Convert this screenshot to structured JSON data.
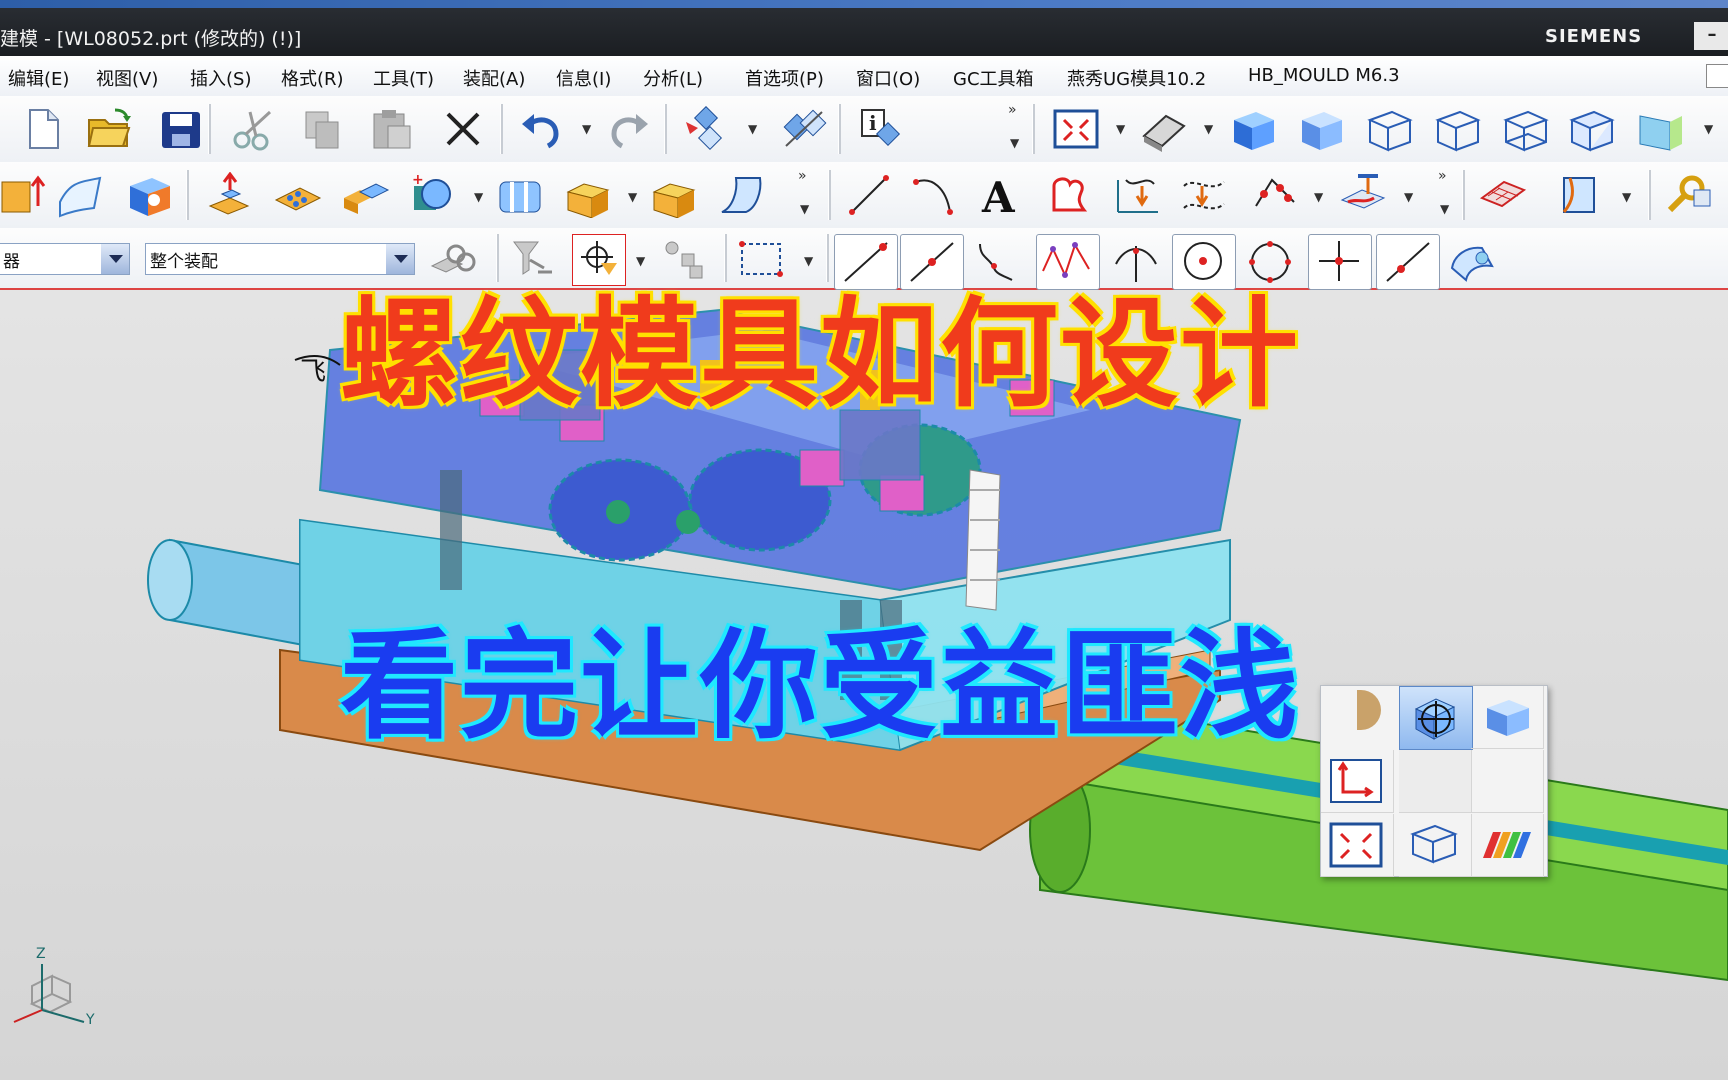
{
  "window": {
    "title": "建模 - [WL08052.prt  (修改的)     (!)]",
    "brand": "SIEMENS",
    "minimize": "–"
  },
  "menu": [
    "编辑(E)",
    "视图(V)",
    "插入(S)",
    "格式(R)",
    "工具(T)",
    "装配(A)",
    "信息(I)",
    "分析(L)",
    "首选项(P)",
    "窗口(O)",
    "GC工具箱",
    "燕秀UG模具10.2",
    "HB_MOULD M6.3"
  ],
  "selection_bar": {
    "filter_value": "器",
    "scope_value": "整个装配"
  },
  "viewport": {
    "sketch_text": "飞",
    "triad_axes": {
      "z": "Z",
      "y": "Y"
    }
  },
  "overlay": {
    "title": "螺纹模具如何设计",
    "subtitle": "看完让你受益匪浅"
  },
  "colors": {
    "title_red": "#f03b1c",
    "title_outline": "#ffe000",
    "subtitle_blue": "#1a3cf0",
    "subtitle_outline": "#20e8ff",
    "mold_blue": "#5b78e0",
    "mold_cyan": "#8fe3f0",
    "base_orange": "#d98a4a",
    "rod_green": "#6cc23a"
  },
  "icons": {
    "toolbar1": [
      "new-file-icon",
      "open-folder-icon",
      "save-icon",
      "cut-icon",
      "copy-icon",
      "paste-icon",
      "delete-icon",
      "undo-icon",
      "redo-icon",
      "selection-filter-icon",
      "repeat-command-icon",
      "information-icon",
      "fit-view-icon",
      "shaded-edges-icon",
      "shaded-icon",
      "wireframe-hidden-icon",
      "wireframe-icon",
      "static-wireframe-icon",
      "face-analysis-icon"
    ],
    "toolbar2": [
      "extrude-icon",
      "surface-icon",
      "block-icon",
      "boss-icon",
      "pad-icon",
      "unite-icon",
      "subtract-icon",
      "cylinder-face-icon",
      "pocket-icon",
      "pocket2-icon",
      "sweep-icon",
      "line-icon",
      "arc-icon",
      "text-icon",
      "outline-icon",
      "project-curve-icon",
      "offset-curve-icon",
      "point-set-icon",
      "curve-on-surface-icon",
      "surface-mesh-icon",
      "extract-face-icon",
      "wrench-icon"
    ],
    "toolbar3": [
      "assembly-constraints-icon",
      "funnel-filter-icon",
      "snap-point-icon",
      "deselect-icon",
      "rectangle-select-icon",
      "snap-end-icon",
      "snap-mid-icon",
      "snap-control-icon",
      "snap-curve-icon",
      "snap-intersection-icon",
      "snap-arc-center-icon",
      "snap-quadrant-icon",
      "snap-point-on-curve-icon",
      "snap-point-on-line-icon",
      "snap-face-icon"
    ]
  }
}
